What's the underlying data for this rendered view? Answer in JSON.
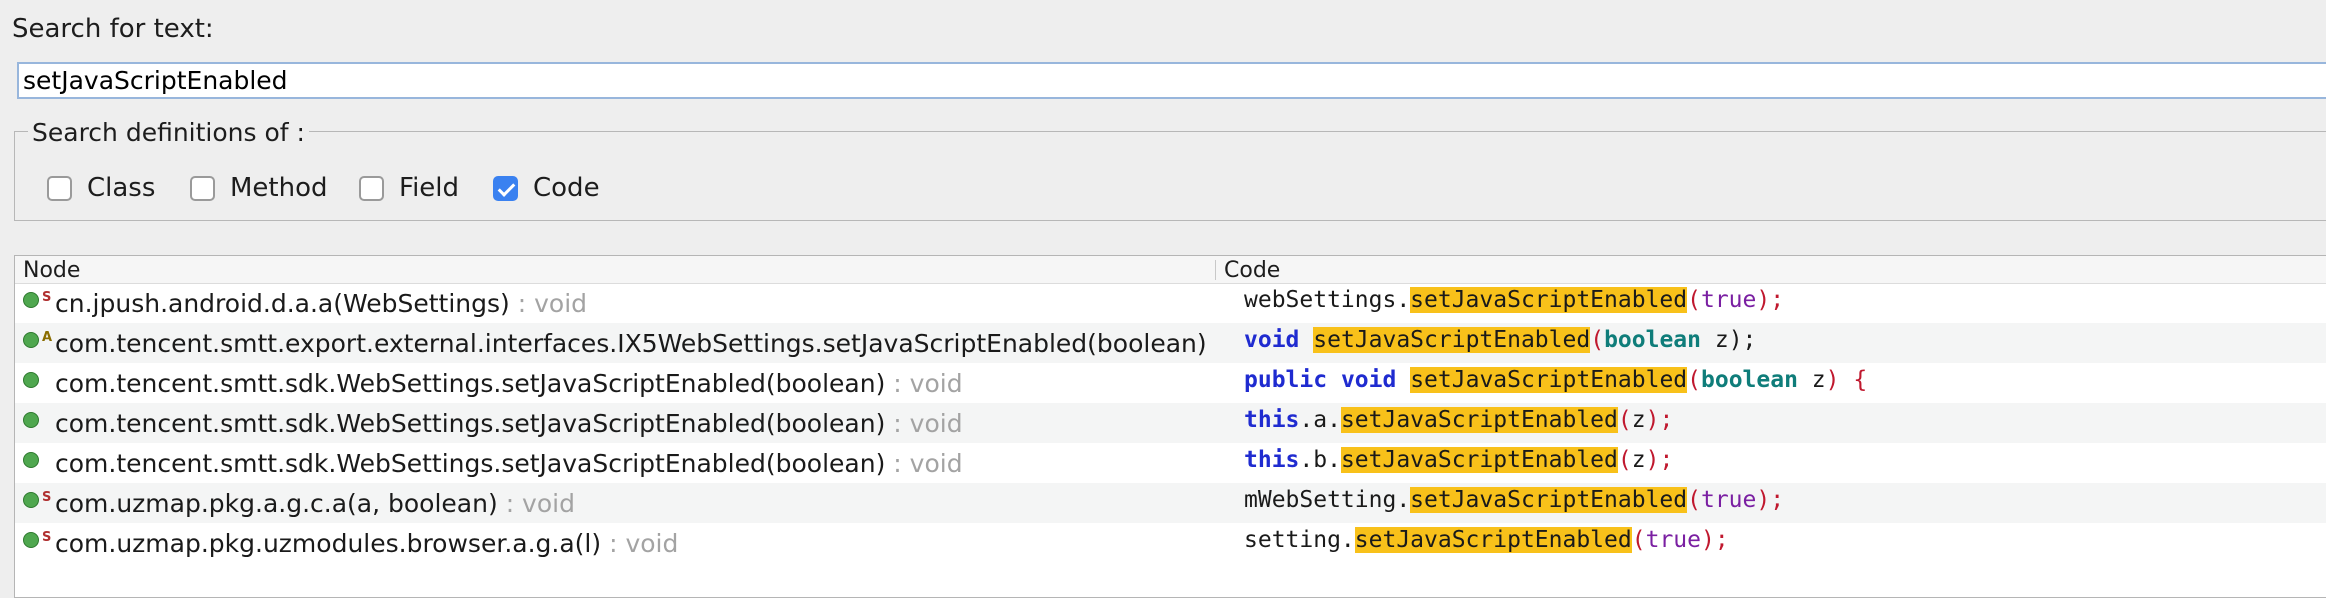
{
  "search": {
    "label": "Search for text:",
    "value": "setJavaScriptEnabled"
  },
  "definitions": {
    "legend": "Search definitions of :",
    "options": [
      {
        "label": "Class",
        "checked": false
      },
      {
        "label": "Method",
        "checked": false
      },
      {
        "label": "Field",
        "checked": false
      },
      {
        "label": "Code",
        "checked": true
      }
    ]
  },
  "results": {
    "headers": {
      "node": "Node",
      "code": "Code"
    },
    "rows": [
      {
        "icon": "static-method-icon",
        "node": "cn.jpush.android.d.a.a(WebSettings)",
        "type": ": void",
        "code": [
          "webSettings.",
          "setJavaScriptEnabled",
          "(",
          "true",
          ");"
        ]
      },
      {
        "icon": "abstract-method-icon",
        "node": "com.tencent.smtt.export.external.interfaces.IX5WebSettings.setJavaScriptEnabled(boolean)",
        "type": ":",
        "code": [
          "void",
          " ",
          "setJavaScriptEnabled",
          "(",
          "boolean",
          " z);"
        ]
      },
      {
        "icon": "method-icon",
        "node": "com.tencent.smtt.sdk.WebSettings.setJavaScriptEnabled(boolean)",
        "type": ": void",
        "code": [
          "public",
          " ",
          "void",
          " ",
          "setJavaScriptEnabled",
          "(",
          "boolean",
          " z",
          ")",
          " {"
        ]
      },
      {
        "icon": "method-icon",
        "node": "com.tencent.smtt.sdk.WebSettings.setJavaScriptEnabled(boolean)",
        "type": ": void",
        "code": [
          "this",
          ".a.",
          "setJavaScriptEnabled",
          "(",
          "z",
          ");"
        ]
      },
      {
        "icon": "method-icon",
        "node": "com.tencent.smtt.sdk.WebSettings.setJavaScriptEnabled(boolean)",
        "type": ": void",
        "code": [
          "this",
          ".b.",
          "setJavaScriptEnabled",
          "(",
          "z",
          ");"
        ]
      },
      {
        "icon": "static-method-icon",
        "node": "com.uzmap.pkg.a.g.c.a(a, boolean)",
        "type": ": void",
        "code": [
          "mWebSetting.",
          "setJavaScriptEnabled",
          "(",
          "true",
          ");"
        ]
      },
      {
        "icon": "static-method-icon",
        "node": "com.uzmap.pkg.uzmodules.browser.a.g.a(l)",
        "type": ": void",
        "code": [
          "setting.",
          "setJavaScriptEnabled",
          "(",
          "true",
          ");"
        ]
      }
    ]
  },
  "colors": {
    "highlight": "#f8c11a",
    "keyword": "#1f2bd0",
    "checkbox_accent": "#3a81f0"
  }
}
